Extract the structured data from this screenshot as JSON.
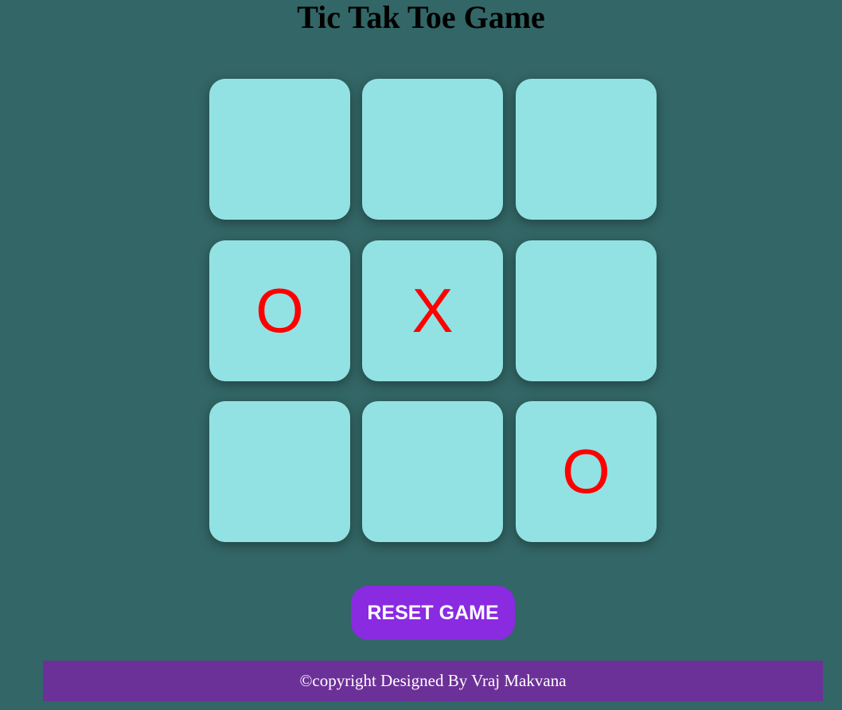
{
  "page": {
    "title": "Tic Tak Toe Game"
  },
  "board": {
    "cells": [
      "",
      "",
      "",
      "O",
      "X",
      "",
      "",
      "",
      "O"
    ]
  },
  "controls": {
    "reset_label": "RESET GAME"
  },
  "footer": {
    "text": "©copyright Designed By Vraj Makvana"
  },
  "colors": {
    "background": "#336666",
    "cell": "#92e2e3",
    "mark": "#ff0000",
    "reset_button": "#8a2be2",
    "footer": "#6c3198"
  }
}
